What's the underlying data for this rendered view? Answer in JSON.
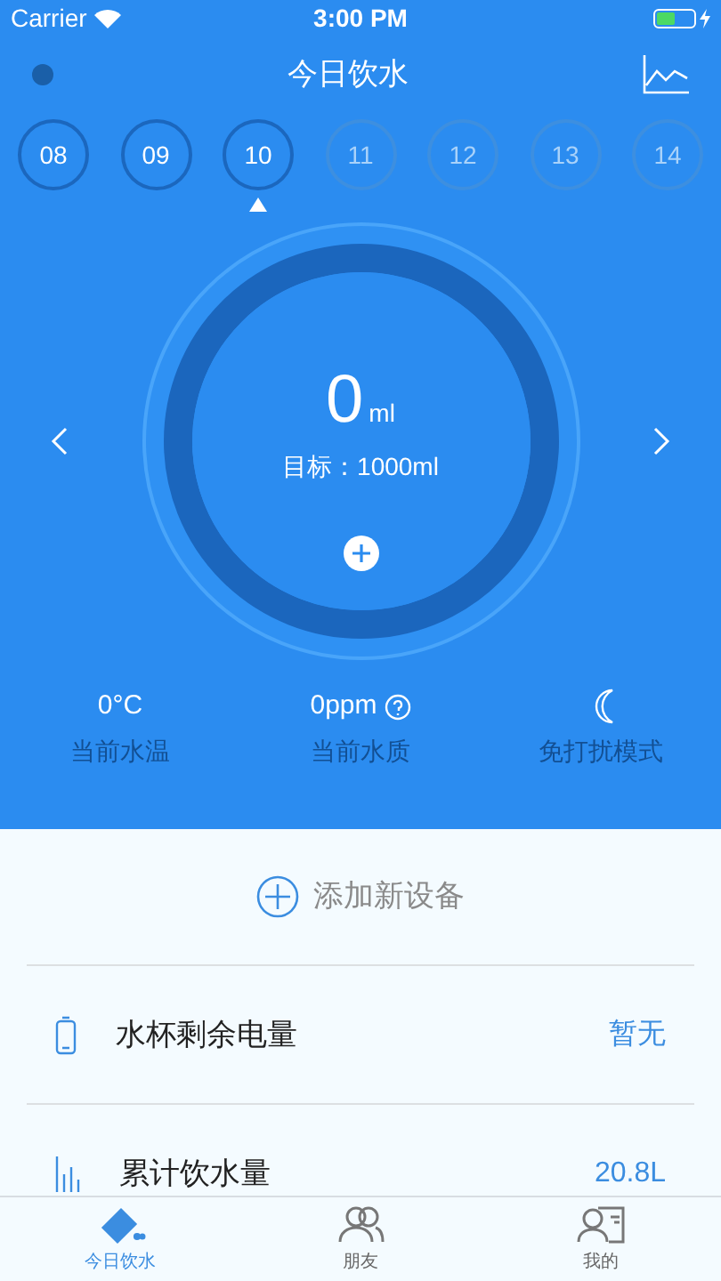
{
  "status_bar": {
    "carrier": "Carrier",
    "time": "3:00 PM"
  },
  "header": {
    "title": "今日饮水",
    "connected": false
  },
  "days": [
    {
      "label": "08",
      "selected": false,
      "disabled": false
    },
    {
      "label": "09",
      "selected": false,
      "disabled": false
    },
    {
      "label": "10",
      "selected": true,
      "disabled": false
    },
    {
      "label": "11",
      "selected": false,
      "disabled": true
    },
    {
      "label": "12",
      "selected": false,
      "disabled": true
    },
    {
      "label": "13",
      "selected": false,
      "disabled": true
    },
    {
      "label": "14",
      "selected": false,
      "disabled": true
    }
  ],
  "gauge": {
    "amount": "0",
    "unit": "ml",
    "goal": "目标：1000ml",
    "level": 0
  },
  "stats": [
    {
      "kind": "temperature",
      "value": "0°C",
      "label": "当前水温"
    },
    {
      "kind": "quality",
      "value": "0ppm",
      "label": "当前水质"
    },
    {
      "kind": "dnd",
      "label": "免打扰模式",
      "on": false
    }
  ],
  "add_device": "添加新设备",
  "rows": [
    {
      "kind": "battery",
      "label": "水杯剩余电量",
      "value": "暂无"
    },
    {
      "kind": "total",
      "label": "累计饮水量",
      "value": "20.8L"
    }
  ],
  "tabs": [
    {
      "kind": "drink",
      "label": "今日饮水",
      "selected": true
    },
    {
      "kind": "friends",
      "label": "朋友",
      "selected": false
    },
    {
      "kind": "me",
      "label": "我的",
      "selected": false
    }
  ]
}
